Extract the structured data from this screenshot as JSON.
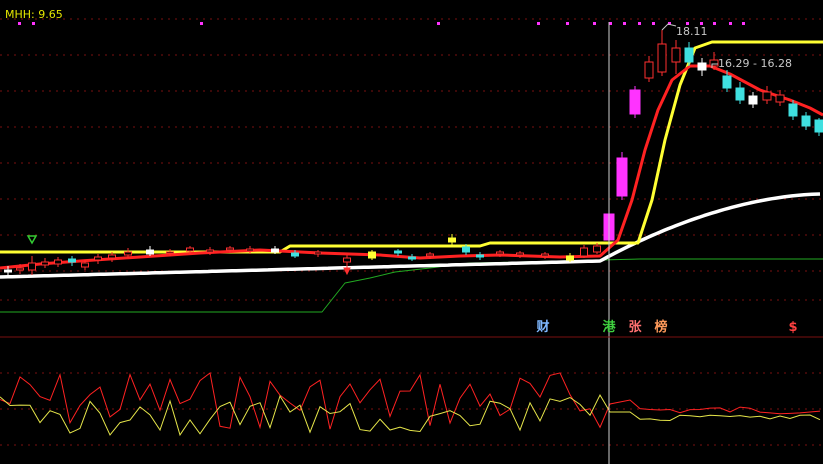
{
  "indicator": {
    "label": "MHH: 9.65"
  },
  "annotations": {
    "high": "18.11",
    "range": "16.29 - 16.28"
  },
  "event_tags": [
    {
      "text": "财",
      "color": "#7fb8ff"
    },
    {
      "text": "港",
      "color": "#3fcf3f"
    },
    {
      "text": "张",
      "color": "#ff7070"
    },
    {
      "text": "榜",
      "color": "#ff9a5a"
    },
    {
      "text": "$",
      "color": "#ff4040"
    }
  ],
  "colors": {
    "up": "#ff3030",
    "down": "#3fe0e0",
    "magenta": "#ff33ff",
    "yellow": "#ffff33",
    "white": "#ffffff",
    "green": "#22aa22",
    "red_line": "#ff2222",
    "grid": "#7a1010"
  }
}
